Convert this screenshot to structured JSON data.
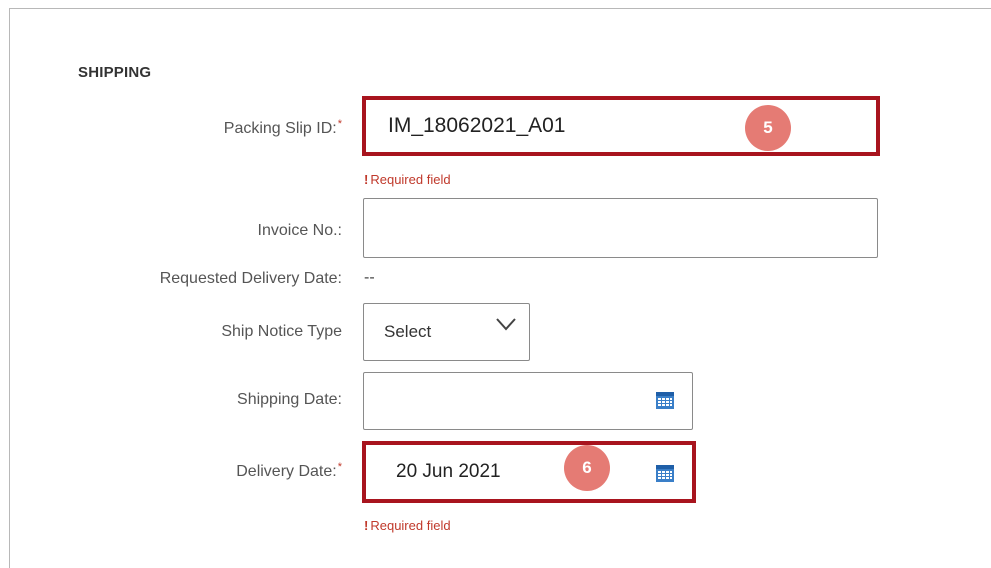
{
  "section": {
    "title": "SHIPPING"
  },
  "fields": {
    "packing_slip": {
      "label": "Packing Slip ID:",
      "required_mark": "*",
      "value": "IM_18062021_A01",
      "error": "Required field"
    },
    "invoice": {
      "label": "Invoice No.:",
      "value": ""
    },
    "requested_delivery": {
      "label": "Requested Delivery Date:",
      "value": "--"
    },
    "ship_notice_type": {
      "label": "Ship Notice Type",
      "selected": "Select"
    },
    "shipping_date": {
      "label": "Shipping Date:",
      "value": ""
    },
    "delivery_date": {
      "label": "Delivery Date:",
      "required_mark": "*",
      "value": "20 Jun 2021",
      "error": "Required field"
    }
  },
  "error_mark": "!",
  "badges": {
    "step5": "5",
    "step6": "6"
  },
  "colors": {
    "highlight": "#a8141e",
    "badge": "#e57b74",
    "error": "#c0392b",
    "calendar": "#3a7fc8"
  },
  "icons": {
    "calendar": "calendar-icon",
    "dropdown": "chevron-down-icon"
  }
}
